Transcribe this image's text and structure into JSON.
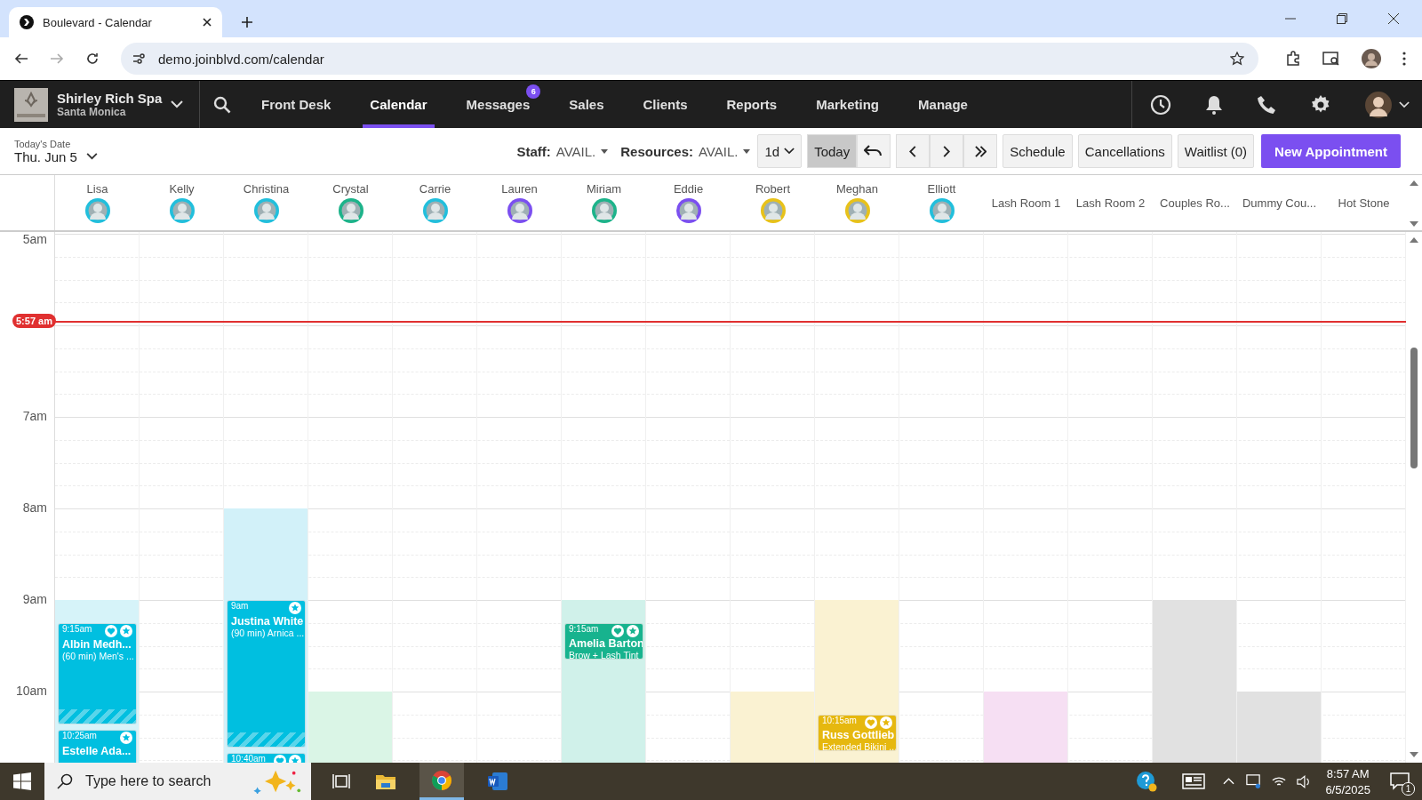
{
  "browser": {
    "tab_title": "Boulevard - Calendar",
    "url": "demo.joinblvd.com/calendar"
  },
  "nav": {
    "business": "Shirley Rich Spa",
    "location": "Santa Monica",
    "tabs": [
      {
        "label": "Front Desk",
        "selected": false
      },
      {
        "label": "Calendar",
        "selected": true
      },
      {
        "label": "Messages",
        "selected": false,
        "badge": "6"
      },
      {
        "label": "Sales",
        "selected": false
      },
      {
        "label": "Clients",
        "selected": false
      },
      {
        "label": "Reports",
        "selected": false
      },
      {
        "label": "Marketing",
        "selected": false
      },
      {
        "label": "Manage",
        "selected": false
      }
    ]
  },
  "toolbar": {
    "date_label": "Today's Date",
    "date": "Thu. Jun 5",
    "staff_label": "Staff:",
    "staff_value": "AVAIL.",
    "resources_label": "Resources:",
    "resources_value": "AVAIL.",
    "view": "1d",
    "today": {
      "label": "Today",
      "selected": true
    },
    "buttons": [
      "Schedule",
      "Cancellations",
      "Waitlist (0)"
    ],
    "primary": "New Appointment"
  },
  "calendar": {
    "hours": [
      "5am",
      "7am",
      "8am",
      "9am",
      "10am"
    ],
    "now": "5:57 am",
    "columns": [
      {
        "name": "Lisa",
        "kind": "staff",
        "color": "#22bfdc",
        "shift": {
          "color": "#d6f3f9",
          "hours": [
            {
              "open": false
            },
            {
              "open": false
            },
            {
              "open": false
            },
            {
              "open": false
            },
            {
              "open": true
            },
            {
              "open": true
            }
          ]
        },
        "appointments": [
          {
            "time": "9:15am",
            "name": "Albin Medh...",
            "detail": "(60 min) Men's ...",
            "color": "#00bfe0",
            "heart": true,
            "star": true,
            "buffer": true
          },
          {
            "time": "10:25am",
            "name": "Estelle Ada...",
            "color": "#00bfe0",
            "heart": false,
            "star": true,
            "buffer": false
          }
        ]
      },
      {
        "name": "Kelly",
        "kind": "staff",
        "color": "#22bfdc"
      },
      {
        "name": "Christina",
        "kind": "staff",
        "color": "#22bfdc",
        "shift": {
          "color": "#d2f1f9",
          "hours": [
            {
              "open": false
            },
            {
              "open": false
            },
            {
              "open": false
            },
            {
              "open": true
            },
            {
              "open": true
            },
            {
              "open": true
            }
          ]
        },
        "appointments": [
          {
            "time": "9am",
            "name": "Justina White",
            "detail": "(90 min) Arnica ...",
            "color": "#00bfe0",
            "heart": false,
            "star": true,
            "buffer": true
          },
          {
            "time": "10:40am",
            "color": "#00bfe0",
            "heart": true,
            "star": true,
            "buffer": false
          }
        ]
      },
      {
        "name": "Crystal",
        "kind": "staff",
        "color": "#1db38a",
        "shift": {
          "color": "#daf5e6",
          "hours": [
            {
              "open": false
            },
            {
              "open": false
            },
            {
              "open": false
            },
            {
              "open": false
            },
            {
              "open": false
            },
            {
              "open": true
            }
          ]
        }
      },
      {
        "name": "Carrie",
        "kind": "staff",
        "color": "#22bfdc"
      },
      {
        "name": "Lauren",
        "kind": "staff",
        "color": "#7b4ff0"
      },
      {
        "name": "Miriam",
        "kind": "staff",
        "color": "#1db38a",
        "shift": {
          "color": "#d0f1ea",
          "hours": [
            {
              "open": false
            },
            {
              "open": false
            },
            {
              "open": false
            },
            {
              "open": false
            },
            {
              "open": true
            },
            {
              "open": true
            }
          ]
        },
        "appointments": [
          {
            "time": "9:15am",
            "name": "Amelia Barton",
            "detail": "Brow + Lash Tint",
            "color": "#17b38e",
            "heart": true,
            "star": true,
            "buffer": false
          }
        ]
      },
      {
        "name": "Eddie",
        "kind": "staff",
        "color": "#7b4ff0"
      },
      {
        "name": "Robert",
        "kind": "staff",
        "color": "#e8c21a",
        "shift": {
          "color": "#faf2d2",
          "hours": [
            {
              "open": false
            },
            {
              "open": false
            },
            {
              "open": false
            },
            {
              "open": false
            },
            {
              "open": false
            },
            {
              "open": true
            }
          ]
        }
      },
      {
        "name": "Meghan",
        "kind": "staff",
        "color": "#e8c21a",
        "shift": {
          "color": "#faf2d2",
          "hours": [
            {
              "open": false
            },
            {
              "open": false
            },
            {
              "open": false
            },
            {
              "open": false
            },
            {
              "open": true
            },
            {
              "open": true
            }
          ]
        },
        "appointments": [
          {
            "time": "10:15am",
            "name": "Russ Gottlieb",
            "detail": "Extended Bikini ...",
            "color": "#e6b80f",
            "heart": true,
            "star": true,
            "buffer": false
          }
        ]
      },
      {
        "name": "Elliott",
        "kind": "staff",
        "color": "#22bfdc"
      },
      {
        "name": "Lash Room 1",
        "kind": "resource",
        "shift": {
          "color": "#f6dff3",
          "hours": [
            {
              "open": false
            },
            {
              "open": false
            },
            {
              "open": false
            },
            {
              "open": false
            },
            {
              "open": false
            },
            {
              "open": true
            }
          ]
        }
      },
      {
        "name": "Lash Room 2",
        "kind": "resource"
      },
      {
        "name": "Couples Ro...",
        "kind": "resource",
        "shift": {
          "color": "#e1e1e1",
          "hours": [
            {
              "open": false
            },
            {
              "open": false
            },
            {
              "open": false
            },
            {
              "open": false
            },
            {
              "open": true
            },
            {
              "open": true
            }
          ]
        }
      },
      {
        "name": "Dummy Cou...",
        "kind": "resource",
        "shift": {
          "color": "#e1e1e1",
          "hours": [
            {
              "open": false
            },
            {
              "open": false
            },
            {
              "open": false
            },
            {
              "open": false
            },
            {
              "open": false
            },
            {
              "open": true
            }
          ]
        }
      },
      {
        "name": "Hot Stone",
        "kind": "resource"
      }
    ]
  },
  "taskbar": {
    "search_placeholder": "Type here to search",
    "time": "8:57 AM",
    "date": "6/5/2025",
    "notifications": "1"
  }
}
